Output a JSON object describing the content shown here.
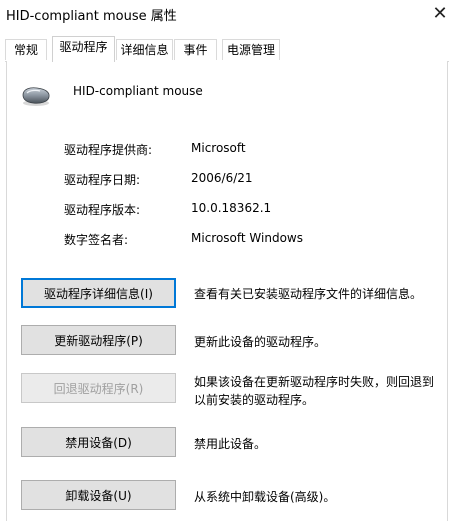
{
  "window": {
    "title": "HID-compliant mouse 属性",
    "close_glyph": "✕"
  },
  "tabs": [
    {
      "label": "常规"
    },
    {
      "label": "驱动程序"
    },
    {
      "label": "详细信息"
    },
    {
      "label": "事件"
    },
    {
      "label": "电源管理"
    }
  ],
  "active_tab": "驱动程序",
  "device": {
    "name": "HID-compliant mouse",
    "icon": "mouse-icon"
  },
  "driver_info": {
    "provider_label": "驱动程序提供商:",
    "provider_value": "Microsoft",
    "date_label": "驱动程序日期:",
    "date_value": "2006/6/21",
    "version_label": "驱动程序版本:",
    "version_value": "10.0.18362.1",
    "signer_label": "数字签名者:",
    "signer_value": "Microsoft Windows"
  },
  "actions": {
    "details_button": "驱动程序详细信息(I)",
    "details_desc": "查看有关已安装驱动程序文件的详细信息。",
    "update_button": "更新驱动程序(P)",
    "update_desc": "更新此设备的驱动程序。",
    "rollback_button": "回退驱动程序(R)",
    "rollback_desc": "如果该设备在更新驱动程序时失败，则回退到以前安装的驱动程序。",
    "disable_button": "禁用设备(D)",
    "disable_desc": "禁用此设备。",
    "uninstall_button": "卸载设备(U)",
    "uninstall_desc": "从系统中卸载设备(高级)。"
  },
  "colors": {
    "focus_border": "#0078d7",
    "button_bg": "#e1e1e1",
    "disabled_text": "#a0a0a0"
  }
}
